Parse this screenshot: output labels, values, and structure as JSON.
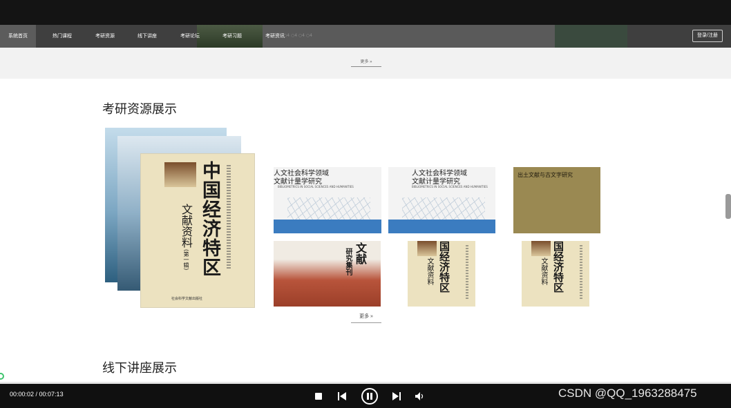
{
  "nav": {
    "items": [
      "系统首页",
      "热门课程",
      "考研资源",
      "线下讲座",
      "考研论坛",
      "考研习题",
      "考研资讯"
    ],
    "login_label": "登录/注册",
    "faint_text": "○4 ○4 ○4 ○4"
  },
  "top_section": {
    "more_label": "更多 »"
  },
  "resources": {
    "title": "考研资源展示",
    "featured_book": {
      "title": "中国经济特区",
      "subtitle": "文献资料",
      "volume": "(第一辑)",
      "publisher": "社会科学文献出版社"
    },
    "books": [
      {
        "title_line1": "人文社会科学领域",
        "title_line2": "文献计量学研究",
        "english": "BIBLIOMETRICS IN SOCIAL SCIENCES AND HUMANITIES"
      },
      {
        "title_line1": "人文社会科学领域",
        "title_line2": "文献计量学研究",
        "english": "BIBLIOMETRICS IN SOCIAL SCIENCES AND HUMANITIES"
      },
      {
        "title": "出土文献与古文字研究"
      },
      {
        "title_main": "文献",
        "title_side": "研究集刊"
      },
      {
        "title": "国经济特区",
        "subtitle": "文献资料"
      },
      {
        "title": "国经济特区",
        "subtitle": "文献资料"
      }
    ],
    "more_label": "更多 »"
  },
  "lectures": {
    "title": "线下讲座展示"
  },
  "player": {
    "time": "00:00:02 / 00:07:13",
    "watermark": "CSDN @QQ_1963288475"
  }
}
